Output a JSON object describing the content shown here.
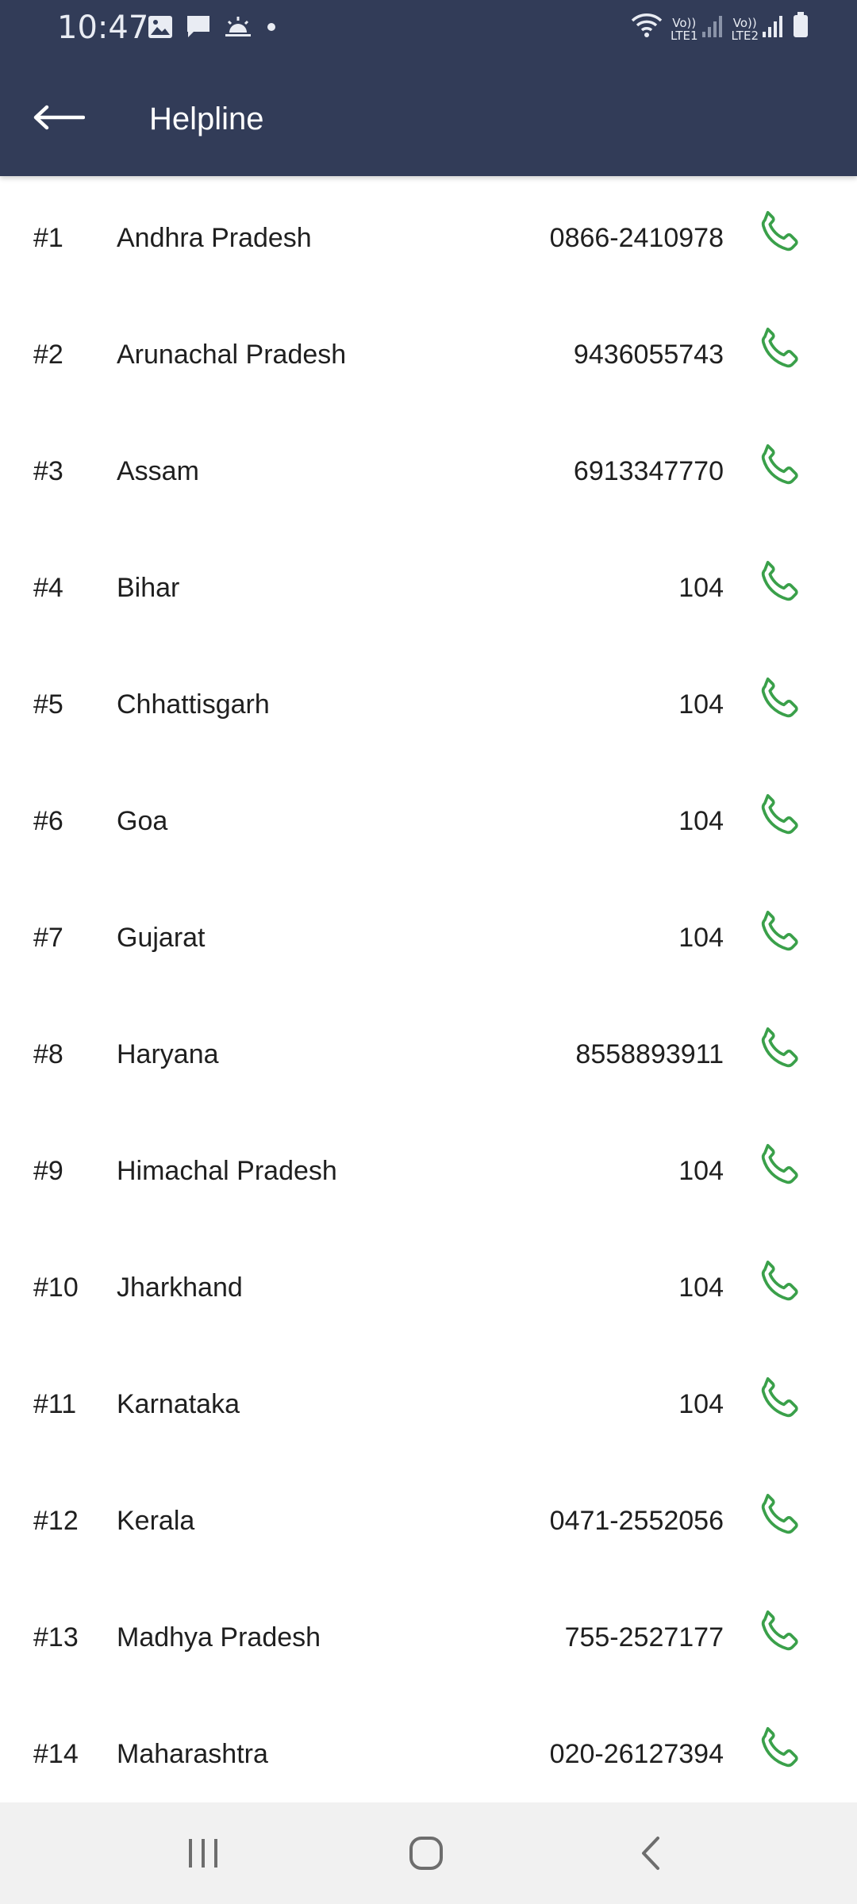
{
  "status_bar": {
    "time": "10:47",
    "left_icons": [
      "image-icon",
      "message-icon",
      "weather-icon",
      "dot-icon"
    ],
    "sim1_label": "Vo))\nLTE1",
    "sim2_label": "Vo))\nLTE2",
    "right_icons": [
      "wifi-icon",
      "signal-icon",
      "signal-icon",
      "battery-icon"
    ]
  },
  "appbar": {
    "title": "Helpline",
    "back_icon": "arrow-left-icon",
    "background": "#323c58"
  },
  "helplines": [
    {
      "index": "#1",
      "state": "Andhra Pradesh",
      "phone": "0866-2410978"
    },
    {
      "index": "#2",
      "state": "Arunachal Pradesh",
      "phone": "9436055743"
    },
    {
      "index": "#3",
      "state": "Assam",
      "phone": "6913347770"
    },
    {
      "index": "#4",
      "state": "Bihar",
      "phone": "104"
    },
    {
      "index": "#5",
      "state": "Chhattisgarh",
      "phone": "104"
    },
    {
      "index": "#6",
      "state": "Goa",
      "phone": "104"
    },
    {
      "index": "#7",
      "state": "Gujarat",
      "phone": "104"
    },
    {
      "index": "#8",
      "state": "Haryana",
      "phone": "8558893911"
    },
    {
      "index": "#9",
      "state": "Himachal Pradesh",
      "phone": "104"
    },
    {
      "index": "#10",
      "state": "Jharkhand",
      "phone": "104"
    },
    {
      "index": "#11",
      "state": "Karnataka",
      "phone": "104"
    },
    {
      "index": "#12",
      "state": "Kerala",
      "phone": "0471-2552056"
    },
    {
      "index": "#13",
      "state": "Madhya Pradesh",
      "phone": "755-2527177"
    },
    {
      "index": "#14",
      "state": "Maharashtra",
      "phone": "020-26127394"
    }
  ],
  "call_icon": "phone-icon",
  "call_icon_color": "#3aa04a",
  "nav_bar": {
    "recents_icon": "recents-icon",
    "home_icon": "home-icon",
    "back_icon": "back-chevron-icon"
  }
}
